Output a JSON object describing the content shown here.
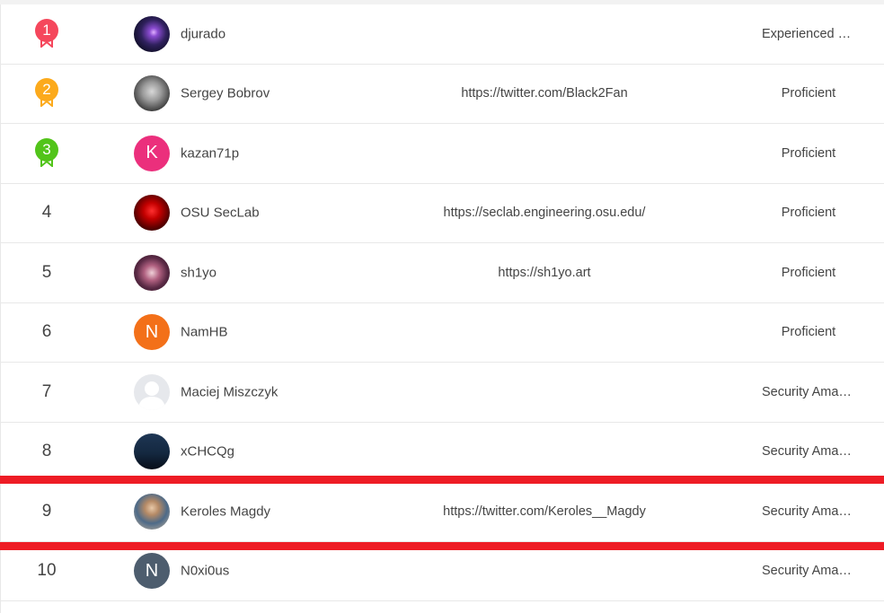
{
  "leaderboard": {
    "rows": [
      {
        "rank": "1",
        "name": "djurado",
        "website": "",
        "level": "Experienced Hacker",
        "level_display": "Experienced …",
        "medal": "gold"
      },
      {
        "rank": "2",
        "name": "Sergey Bobrov",
        "website": "https://twitter.com/Black2Fan",
        "level": "Proficient",
        "level_display": "Proficient",
        "medal": "silver"
      },
      {
        "rank": "3",
        "name": "kazan71p",
        "website": "",
        "level": "Proficient",
        "level_display": "Proficient",
        "medal": "bronze",
        "avatar_letter": "K"
      },
      {
        "rank": "4",
        "name": "OSU SecLab",
        "website": "https://seclab.engineering.osu.edu/",
        "level": "Proficient",
        "level_display": "Proficient"
      },
      {
        "rank": "5",
        "name": "sh1yo",
        "website": "https://sh1yo.art",
        "level": "Proficient",
        "level_display": "Proficient"
      },
      {
        "rank": "6",
        "name": "NamHB",
        "website": "",
        "level": "Proficient",
        "level_display": "Proficient",
        "avatar_letter": "N"
      },
      {
        "rank": "7",
        "name": "Maciej Miszczyk",
        "website": "",
        "level": "Security Amateur",
        "level_display": "Security Ama…"
      },
      {
        "rank": "8",
        "name": "xCHCQg",
        "website": "",
        "level": "Security Amateur",
        "level_display": "Security Ama…"
      },
      {
        "rank": "9",
        "name": "Keroles Magdy",
        "website": "https://twitter.com/Keroles__Magdy",
        "level": "Security Amateur",
        "level_display": "Security Ama…"
      },
      {
        "rank": "10",
        "name": "N0xi0us",
        "website": "",
        "level": "Security Amateur",
        "level_display": "Security Ama…",
        "avatar_letter": "N"
      }
    ]
  },
  "colors": {
    "medal_1": "#f5475c",
    "medal_2": "#fcaa1c",
    "medal_3": "#52c41a",
    "avatar_k": "#eb2f7c",
    "avatar_n_orange": "#f37019",
    "avatar_n_gray": "#4d5d6e",
    "highlight": "#ee1c25"
  },
  "icons": {
    "medal": "bookmark-ribbon-medal-icon"
  }
}
